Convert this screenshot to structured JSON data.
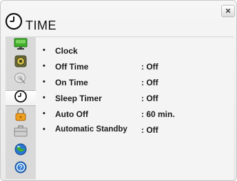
{
  "window": {
    "title": "TIME",
    "close_label": "×",
    "title_icon": "clock-icon"
  },
  "sidebar": {
    "items": [
      {
        "name": "picture",
        "icon": "monitor-icon"
      },
      {
        "name": "audio",
        "icon": "speaker-icon"
      },
      {
        "name": "setup",
        "icon": "satellite-dish-icon"
      },
      {
        "name": "time",
        "icon": "clock-icon",
        "active": true
      },
      {
        "name": "lock",
        "icon": "padlock-icon"
      },
      {
        "name": "option",
        "icon": "toolbox-icon"
      },
      {
        "name": "network",
        "icon": "globe-icon"
      },
      {
        "name": "support",
        "icon": "help-icon"
      }
    ]
  },
  "menu": {
    "bullet": "•",
    "items": [
      {
        "label": "Clock",
        "value": ""
      },
      {
        "label": "Off Time",
        "value": ": Off"
      },
      {
        "label": "On Time",
        "value": ": Off"
      },
      {
        "label": "Sleep Timer",
        "value": ": Off"
      },
      {
        "label": "Auto Off",
        "value": ": 60 min."
      },
      {
        "label": "Automatic Standby",
        "value": ": Off"
      }
    ]
  },
  "colors": {
    "accent_green": "#3fae2a",
    "accent_blue": "#2a77d0",
    "frame_border": "#c9c9c9"
  }
}
